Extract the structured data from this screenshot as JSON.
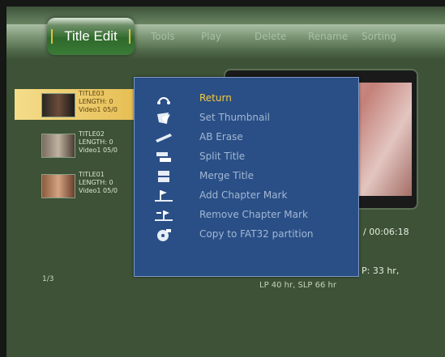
{
  "tabs": {
    "active": "Title Edit",
    "others": [
      "Tools",
      "Play",
      "Delete",
      "Rename",
      "Sorting"
    ]
  },
  "titles": [
    {
      "name": "TITLE03",
      "length": "LENGTH: 0",
      "source": "Video1 05/0",
      "selected": true
    },
    {
      "name": "TITLE02",
      "length": "LENGTH: 0",
      "source": "Video1 05/0",
      "selected": false
    },
    {
      "name": "TITLE01",
      "length": "LENGTH: 0",
      "source": "Video1 05/0",
      "selected": false
    }
  ],
  "page_indicator": "1/3",
  "preview": {
    "time": "/ 00:06:18",
    "space": "P: 33 hr,",
    "free": "LP 40 hr,    SLP 66 hr"
  },
  "menu": {
    "items": [
      {
        "label": "Return",
        "icon": "return-icon",
        "active": true
      },
      {
        "label": "Set Thumbnail",
        "icon": "thumbnail-icon",
        "active": false
      },
      {
        "label": "AB Erase",
        "icon": "erase-icon",
        "active": false
      },
      {
        "label": "Split Title",
        "icon": "split-icon",
        "active": false
      },
      {
        "label": "Merge Title",
        "icon": "merge-icon",
        "active": false
      },
      {
        "label": "Add Chapter Mark",
        "icon": "add-chapter-icon",
        "active": false
      },
      {
        "label": "Remove Chapter Mark",
        "icon": "remove-chapter-icon",
        "active": false
      },
      {
        "label": "Copy to FAT32 partition",
        "icon": "copy-icon",
        "active": false
      }
    ]
  },
  "colors": {
    "menu_bg": "#2a4f86",
    "highlight": "#f6ca3c",
    "background": "#3d5236"
  }
}
